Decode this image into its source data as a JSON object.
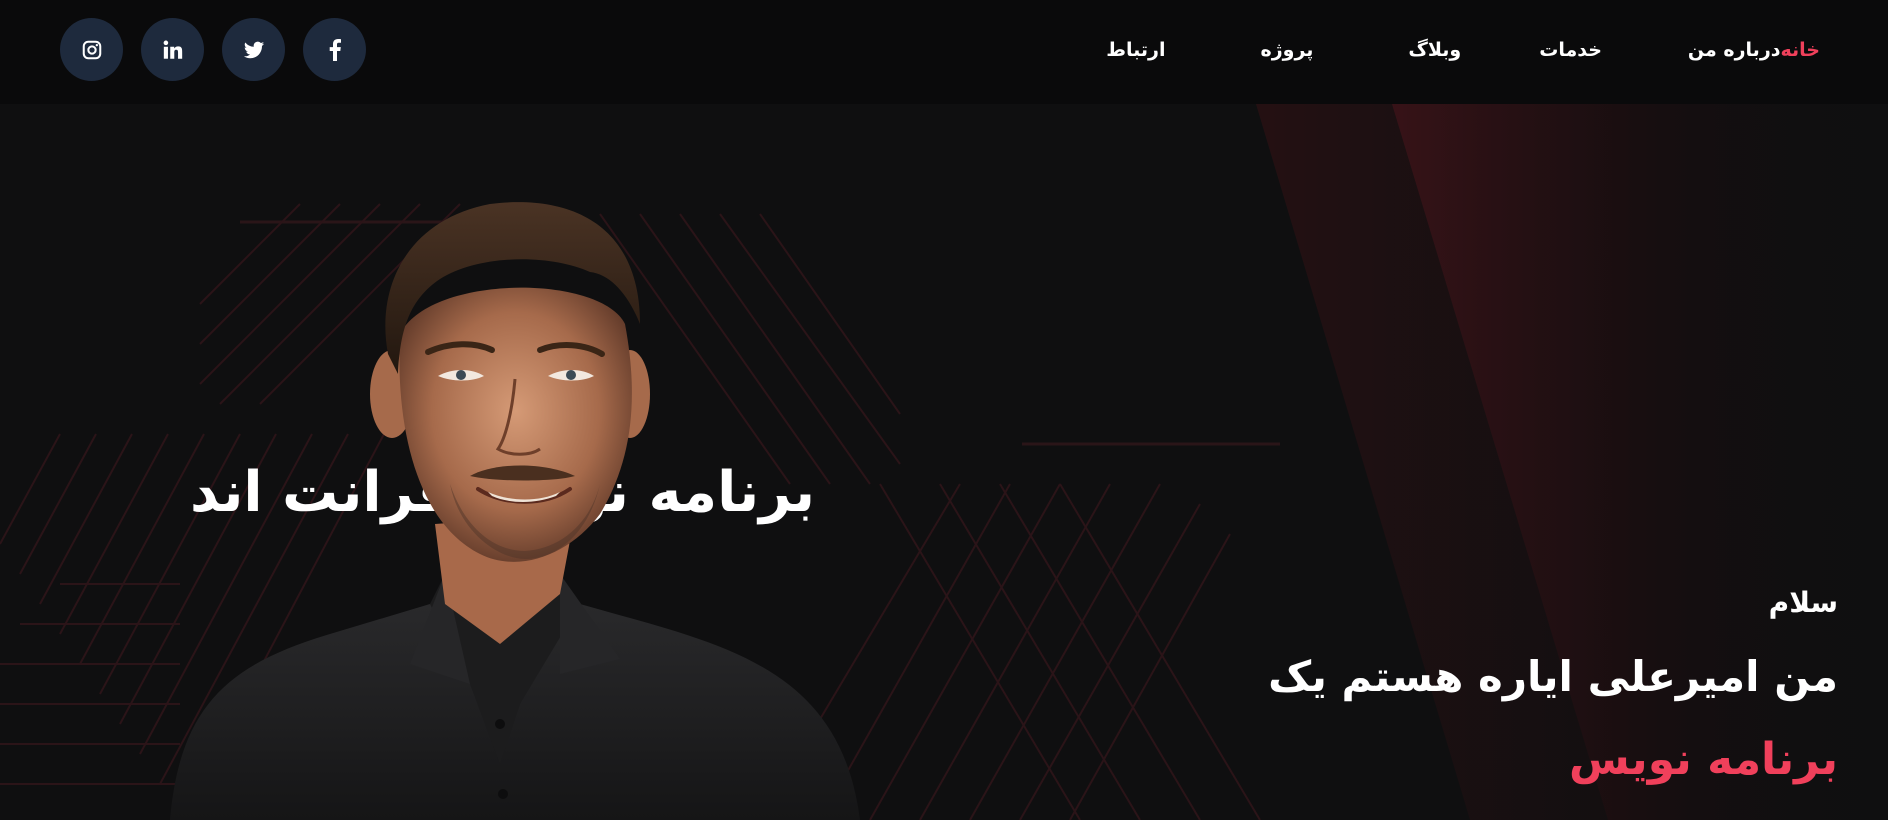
{
  "header": {
    "nav": [
      {
        "label": "خانه",
        "active": true
      },
      {
        "label": "درباره من",
        "active": false
      },
      {
        "label": "خدمات",
        "active": false
      },
      {
        "label": "وبلاگ",
        "active": false
      },
      {
        "label": "پروژه",
        "active": false
      },
      {
        "label": "ارتباط",
        "active": false
      }
    ],
    "socials": [
      "instagram-icon",
      "linkedin-icon",
      "twitter-icon",
      "facebook-icon"
    ]
  },
  "hero": {
    "background_heading": "برنامه نویس فرانت اند",
    "greeting": "سلام",
    "name_line": "من امیرعلی ایاره هستم یک",
    "role": "برنامه نویس"
  },
  "colors": {
    "accent": "#f0405b",
    "background": "#0f0f10",
    "header_bg": "#0a0a0b",
    "social_bg": "#1e2a3d"
  }
}
